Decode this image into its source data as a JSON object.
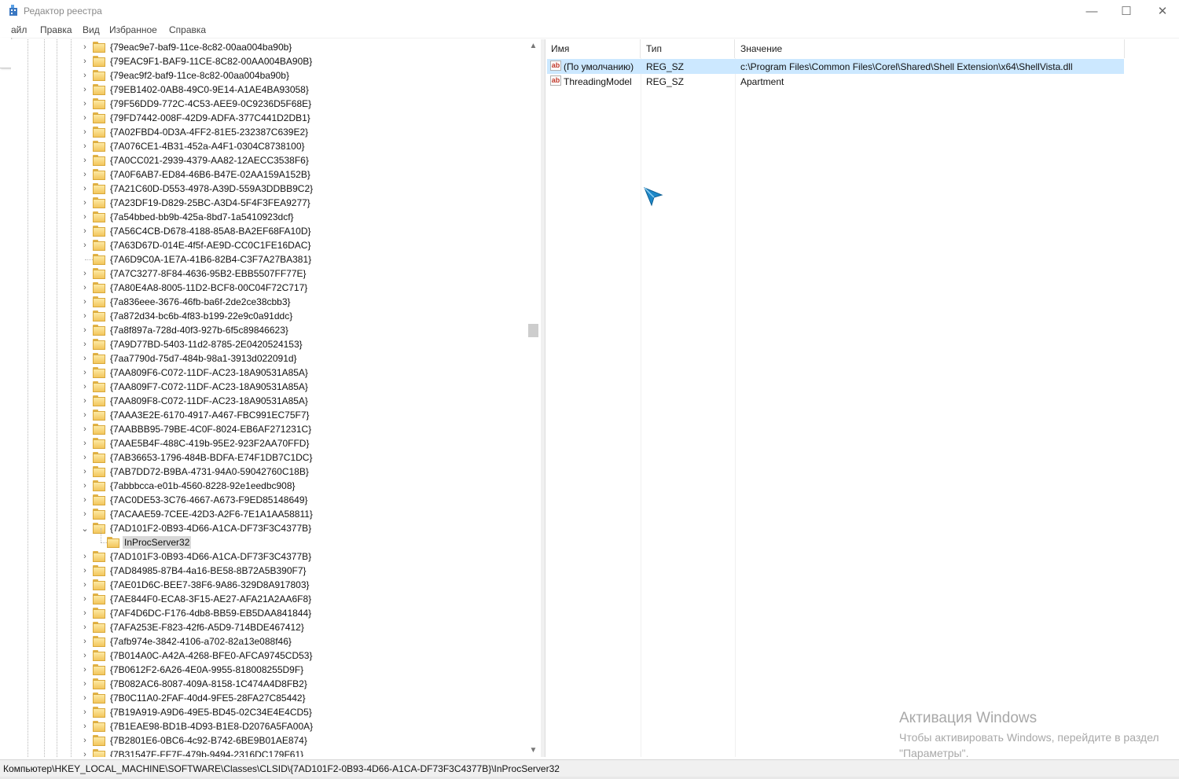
{
  "window": {
    "title": "Редактор реестра",
    "controls": {
      "minimize": "—",
      "maximize": "☐",
      "close": "✕"
    }
  },
  "menu": [
    "айл",
    "Правка",
    "Вид",
    "Избранное",
    "Справка"
  ],
  "tree": {
    "items": [
      {
        "label": "{79eac9e7-baf9-11ce-8c82-00aa004ba90b}",
        "expander": "›"
      },
      {
        "label": "{79EAC9F1-BAF9-11CE-8C82-00AA004BA90B}",
        "expander": "›"
      },
      {
        "label": "{79eac9f2-baf9-11ce-8c82-00aa004ba90b}",
        "expander": "›"
      },
      {
        "label": "{79EB1402-0AB8-49C0-9E14-A1AE4BA93058}",
        "expander": "›"
      },
      {
        "label": "{79F56DD9-772C-4C53-AEE9-0C9236D5F68E}",
        "expander": "›"
      },
      {
        "label": "{79FD7442-008F-42D9-ADFA-377C441D2DB1}",
        "expander": "›"
      },
      {
        "label": "{7A02FBD4-0D3A-4FF2-81E5-232387C639E2}",
        "expander": "›"
      },
      {
        "label": "{7A076CE1-4B31-452a-A4F1-0304C8738100}",
        "expander": "›"
      },
      {
        "label": "{7A0CC021-2939-4379-AA82-12AECC3538F6}",
        "expander": "›"
      },
      {
        "label": "{7A0F6AB7-ED84-46B6-B47E-02AA159A152B}",
        "expander": "›"
      },
      {
        "label": "{7A21C60D-D553-4978-A39D-559A3DDBB9C2}",
        "expander": "›"
      },
      {
        "label": "{7A23DF19-D829-25BC-A3D4-5F4F3FEA9277}",
        "expander": "›"
      },
      {
        "label": "{7a54bbed-bb9b-425a-8bd7-1a5410923dcf}",
        "expander": "›"
      },
      {
        "label": "{7A56C4CB-D678-4188-85A8-BA2EF68FA10D}",
        "expander": "›"
      },
      {
        "label": "{7A63D67D-014E-4f5f-AE9D-CC0C1FE16DAC}",
        "expander": "›"
      },
      {
        "label": "{7A6D9C0A-1E7A-41B6-82B4-C3F7A27BA381}",
        "expander": ""
      },
      {
        "label": "{7A7C3277-8F84-4636-95B2-EBB5507FF77E}",
        "expander": "›"
      },
      {
        "label": "{7A80E4A8-8005-11D2-BCF8-00C04F72C717}",
        "expander": "›"
      },
      {
        "label": "{7a836eee-3676-46fb-ba6f-2de2ce38cbb3}",
        "expander": "›"
      },
      {
        "label": "{7a872d34-bc6b-4f83-b199-22e9c0a91ddc}",
        "expander": "›"
      },
      {
        "label": "{7a8f897a-728d-40f3-927b-6f5c89846623}",
        "expander": "›"
      },
      {
        "label": "{7A9D77BD-5403-11d2-8785-2E0420524153}",
        "expander": "›"
      },
      {
        "label": "{7aa7790d-75d7-484b-98a1-3913d022091d}",
        "expander": "›"
      },
      {
        "label": "{7AA809F6-C072-11DF-AC23-18A90531A85A}",
        "expander": "›"
      },
      {
        "label": "{7AA809F7-C072-11DF-AC23-18A90531A85A}",
        "expander": "›"
      },
      {
        "label": "{7AA809F8-C072-11DF-AC23-18A90531A85A}",
        "expander": "›"
      },
      {
        "label": "{7AAA3E2E-6170-4917-A467-FBC991EC75F7}",
        "expander": "›"
      },
      {
        "label": "{7AABBB95-79BE-4C0F-8024-EB6AF271231C}",
        "expander": "›"
      },
      {
        "label": "{7AAE5B4F-488C-419b-95E2-923F2AA70FFD}",
        "expander": "›"
      },
      {
        "label": "{7AB36653-1796-484B-BDFA-E74F1DB7C1DC}",
        "expander": "›"
      },
      {
        "label": "{7AB7DD72-B9BA-4731-94A0-59042760C18B}",
        "expander": "›"
      },
      {
        "label": "{7abbbcca-e01b-4560-8228-92e1eedbc908}",
        "expander": "›"
      },
      {
        "label": "{7AC0DE53-3C76-4667-A673-F9ED85148649}",
        "expander": "›"
      },
      {
        "label": "{7ACAAE59-7CEE-42D3-A2F6-7E1A1AA58811}",
        "expander": "›"
      },
      {
        "label": "{7AD101F2-0B93-4D66-A1CA-DF73F3C4377B}",
        "expander": "⌄"
      },
      {
        "label": "InProcServer32",
        "expander": "",
        "child": true,
        "selected": true
      },
      {
        "label": "{7AD101F3-0B93-4D66-A1CA-DF73F3C4377B}",
        "expander": "›"
      },
      {
        "label": "{7AD84985-87B4-4a16-BE58-8B72A5B390F7}",
        "expander": "›"
      },
      {
        "label": "{7AE01D6C-BEE7-38F6-9A86-329D8A917803}",
        "expander": "›"
      },
      {
        "label": "{7AE844F0-ECA8-3F15-AE27-AFA21A2AA6F8}",
        "expander": "›"
      },
      {
        "label": "{7AF4D6DC-F176-4db8-BB59-EB5DAA841844}",
        "expander": "›"
      },
      {
        "label": "{7AFA253E-F823-42f6-A5D9-714BDE467412}",
        "expander": "›"
      },
      {
        "label": "{7afb974e-3842-4106-a702-82a13e088f46}",
        "expander": "›"
      },
      {
        "label": "{7B014A0C-A42A-4268-BFE0-AFCA9745CD53}",
        "expander": "›"
      },
      {
        "label": "{7B0612F2-6A26-4E0A-9955-818008255D9F}",
        "expander": "›"
      },
      {
        "label": "{7B082AC6-8087-409A-8158-1C474A4D8FB2}",
        "expander": "›"
      },
      {
        "label": "{7B0C11A0-2FAF-40d4-9FE5-28FA27C85442}",
        "expander": "›"
      },
      {
        "label": "{7B19A919-A9D6-49E5-BD45-02C34E4E4CD5}",
        "expander": "›"
      },
      {
        "label": "{7B1EAE98-BD1B-4D93-B1E8-D2076A5FA00A}",
        "expander": "›"
      },
      {
        "label": "{7B2801E6-0BC6-4c92-B742-6BE9B01AE874}",
        "expander": "›"
      },
      {
        "label": "{7B31547F-FF7F-479b-9494-2316DC179F61}",
        "expander": "›"
      }
    ]
  },
  "list": {
    "columns": [
      "Имя",
      "Тип",
      "Значение"
    ],
    "rows": [
      {
        "name": "(По умолчанию)",
        "type": "REG_SZ",
        "value": "c:\\Program Files\\Common Files\\Corel\\Shared\\Shell Extension\\x64\\ShellVista.dll",
        "icon": "ab",
        "selected": true
      },
      {
        "name": "ThreadingModel",
        "type": "REG_SZ",
        "value": "Apartment",
        "icon": "ab",
        "selected": false
      }
    ]
  },
  "activation": {
    "title": "Активация Windows",
    "line1": "Чтобы активировать Windows, перейдите в раздел",
    "line2": "\"Параметры\"."
  },
  "statusbar": {
    "path": "Компьютер\\HKEY_LOCAL_MACHINE\\SOFTWARE\\Classes\\CLSID\\{7AD101F2-0B93-4D66-A1CA-DF73F3C4377B}\\InProcServer32"
  },
  "colors": {
    "selection_list": "#cce8ff",
    "selection_tree": "#d9d9d9",
    "folder": "#f3c65c",
    "cursor": "#1e88c8"
  },
  "icons": {
    "app": "registry-editor-icon",
    "tree_item": "folder-icon",
    "value": "string-value-icon",
    "pointer": "mouse-cursor-icon"
  }
}
